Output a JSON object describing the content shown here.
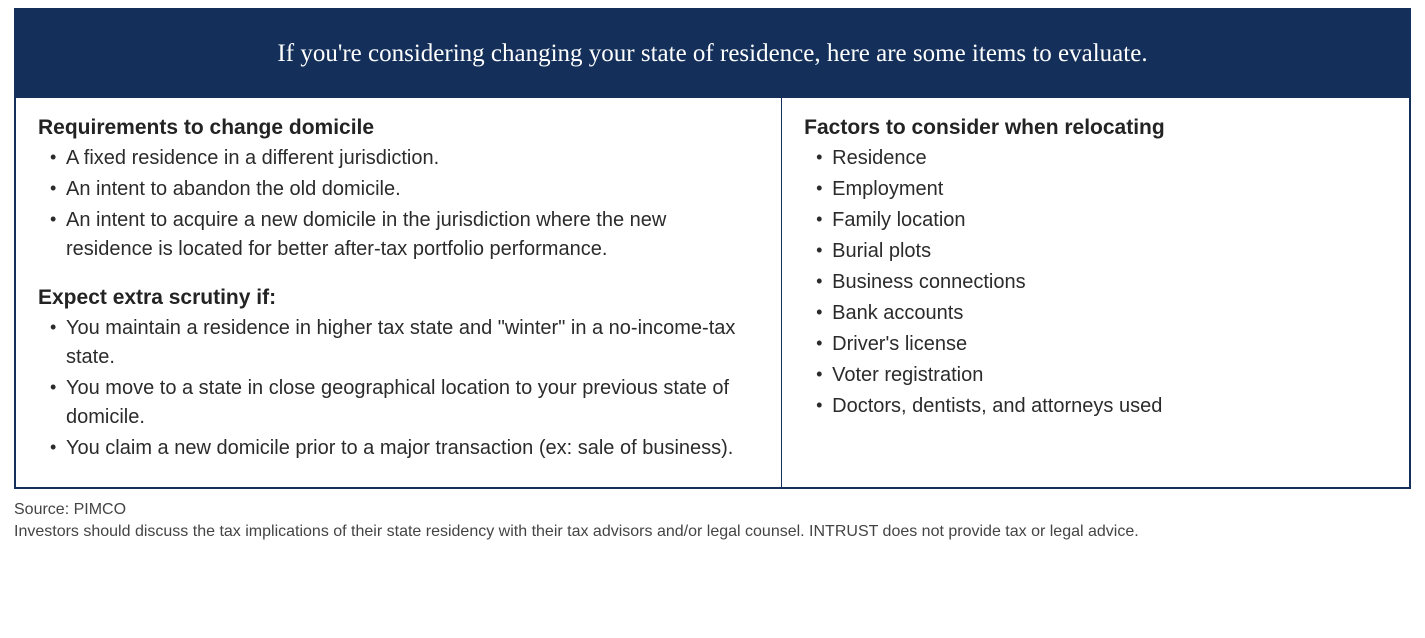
{
  "header": {
    "title": "If you're considering changing your state of residence, here are some items to evaluate."
  },
  "left": {
    "sections": [
      {
        "heading": "Requirements to change domicile",
        "bullets": [
          "A fixed residence in a different jurisdiction.",
          "An intent to abandon the old domicile.",
          "An intent to acquire a new domicile in the jurisdiction where the new residence is located for better after-tax portfolio performance."
        ]
      },
      {
        "heading": "Expect extra scrutiny if:",
        "bullets": [
          "You maintain a residence in higher tax state and \"winter\" in a no-income-tax state.",
          "You move to a state in close geographical location to your previous state of domicile.",
          "You claim a new domicile prior to a major transaction (ex: sale of business)."
        ]
      }
    ]
  },
  "right": {
    "heading": "Factors to consider when relocating",
    "bullets": [
      "Residence",
      "Employment",
      "Family location",
      "Burial plots",
      "Business connections",
      "Bank accounts",
      "Driver's license",
      "Voter registration",
      "Doctors, dentists, and attorneys used"
    ]
  },
  "footnote": {
    "source": "Source: PIMCO",
    "disclaimer": "Investors should discuss the tax implications of their state residency with their tax advisors and/or legal counsel. INTRUST does not provide tax or legal advice."
  }
}
